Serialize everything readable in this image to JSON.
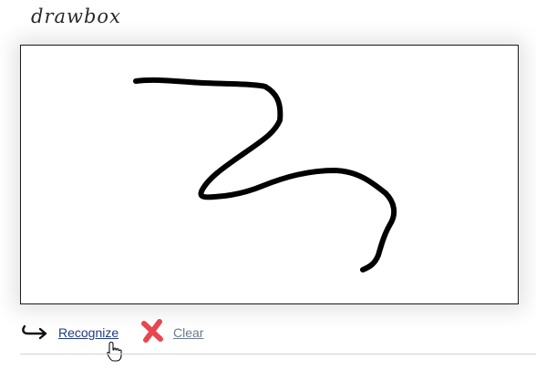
{
  "app": {
    "title": "drawbox"
  },
  "canvas": {
    "stroke_color": "#000000"
  },
  "toolbar": {
    "recognize_label": "Recognize",
    "clear_label": "Clear",
    "recognize_icon": "return-arrow-icon",
    "clear_icon": "red-x-icon"
  },
  "colors": {
    "link_active": "#1f3a8a",
    "link_muted": "#6a7b8c",
    "clear_icon": "#e8474f"
  }
}
